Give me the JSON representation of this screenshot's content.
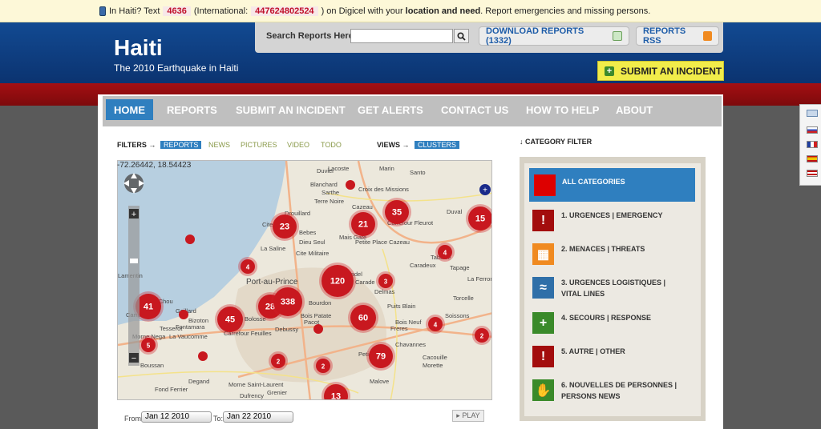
{
  "notice": {
    "text1": "In Haiti? Text",
    "num1": "4636",
    "text2": "(International:",
    "num2": "447624802524",
    "text3": ") on Digicel with your",
    "bold1": "location and need",
    "text4": ". Report emergencies and missing persons."
  },
  "header": {
    "title": "Haiti",
    "subtitle": "The 2010 Earthquake in Haiti",
    "search_label": "Search Reports Here:",
    "download_label": "DOWNLOAD REPORTS (1332)",
    "rss_label": "REPORTS RSS",
    "submit_label": "SUBMIT AN INCIDENT"
  },
  "nav": [
    "HOME",
    "REPORTS",
    "SUBMIT AN INCIDENT",
    "GET ALERTS",
    "CONTACT US",
    "HOW TO HELP",
    "ABOUT"
  ],
  "filters": {
    "label": "FILTERS",
    "tabs": [
      "REPORTS",
      "NEWS",
      "PICTURES",
      "VIDEO",
      "TODO"
    ],
    "views_label": "VIEWS",
    "views_tab": "CLUSTERS"
  },
  "map": {
    "coordinate_readout": "-72.26442, 18.54423",
    "places": [
      "Duvier",
      "Lacoste",
      "Marin",
      "Santo",
      "Blanchard",
      "Croix des Missions",
      "Sarthe",
      "Terre Noire",
      "Cazeau",
      "Drouillard",
      "Duval",
      "Cite Soleil",
      "Bebes",
      "Carrefour Fleurot",
      "Dieu Seul",
      "Mais Gate",
      "Petite Place Cazeau",
      "La Saline",
      "Cite Militaire",
      "Caradeux",
      "Tabarre",
      "Tapage",
      "Port-au-Prince",
      "Zone Pradel",
      "Carade",
      "Delmas",
      "La Ferrone",
      "Bourdon",
      "Torcelle",
      "Puits Blain",
      "Carrefour",
      "Gaillard",
      "Bizoton",
      "Bolosse",
      "Bois Patate",
      "Soissons",
      "Tesserot",
      "Fontamara",
      "Pacot",
      "Bois Neuf",
      "Morne Nega",
      "Carrefour Feuilles",
      "Debussy",
      "Freres",
      "La Vaucomme",
      "Boussan",
      "Chavannes",
      "Petion-Ville",
      "Cacouille",
      "Morette",
      "Degand",
      "Morne Saint-Laurent",
      "Grenier",
      "Fond Ferrier",
      "Malove",
      "Dufrency",
      "Lamentin",
      "Vieux Chou"
    ],
    "clusters": [
      "23",
      "21",
      "35",
      "15",
      "4",
      "120",
      "3",
      "4",
      "41",
      "28",
      "338",
      "45",
      "60",
      "4",
      "2",
      "5",
      "79",
      "2",
      "2",
      "13"
    ]
  },
  "timeline": {
    "from_label": "From:",
    "from_value": "Jan 12 2010",
    "to_label": "To:",
    "to_value": "Jan 22 2010",
    "play_label": "PLAY"
  },
  "categories": {
    "header": "CATEGORY FILTER",
    "all_label": "ALL CATEGORIES",
    "items": [
      {
        "line1": "1. URGENCES | EMERGENCY",
        "line2": "",
        "color": "#a30d0d",
        "icon": "exclamation-icon"
      },
      {
        "line1": "2. MENACES | THREATS",
        "line2": "",
        "color": "#f08a20",
        "icon": "grid-icon"
      },
      {
        "line1": "3. URGENCES LOGISTIQUES |",
        "line2": "VITAL LINES",
        "color": "#2f6fa8",
        "icon": "water-drops-icon"
      },
      {
        "line1": "4. SECOURS | RESPONSE",
        "line2": "",
        "color": "#3a8a2a",
        "icon": "plus-icon"
      },
      {
        "line1": "5. AUTRE | OTHER",
        "line2": "",
        "color": "#a30d0d",
        "icon": "exclamation-icon"
      },
      {
        "line1": "6. NOUVELLES DE PERSONNES |",
        "line2": "PERSONS NEWS",
        "color": "#3a8a2a",
        "icon": "people-icon"
      }
    ]
  }
}
